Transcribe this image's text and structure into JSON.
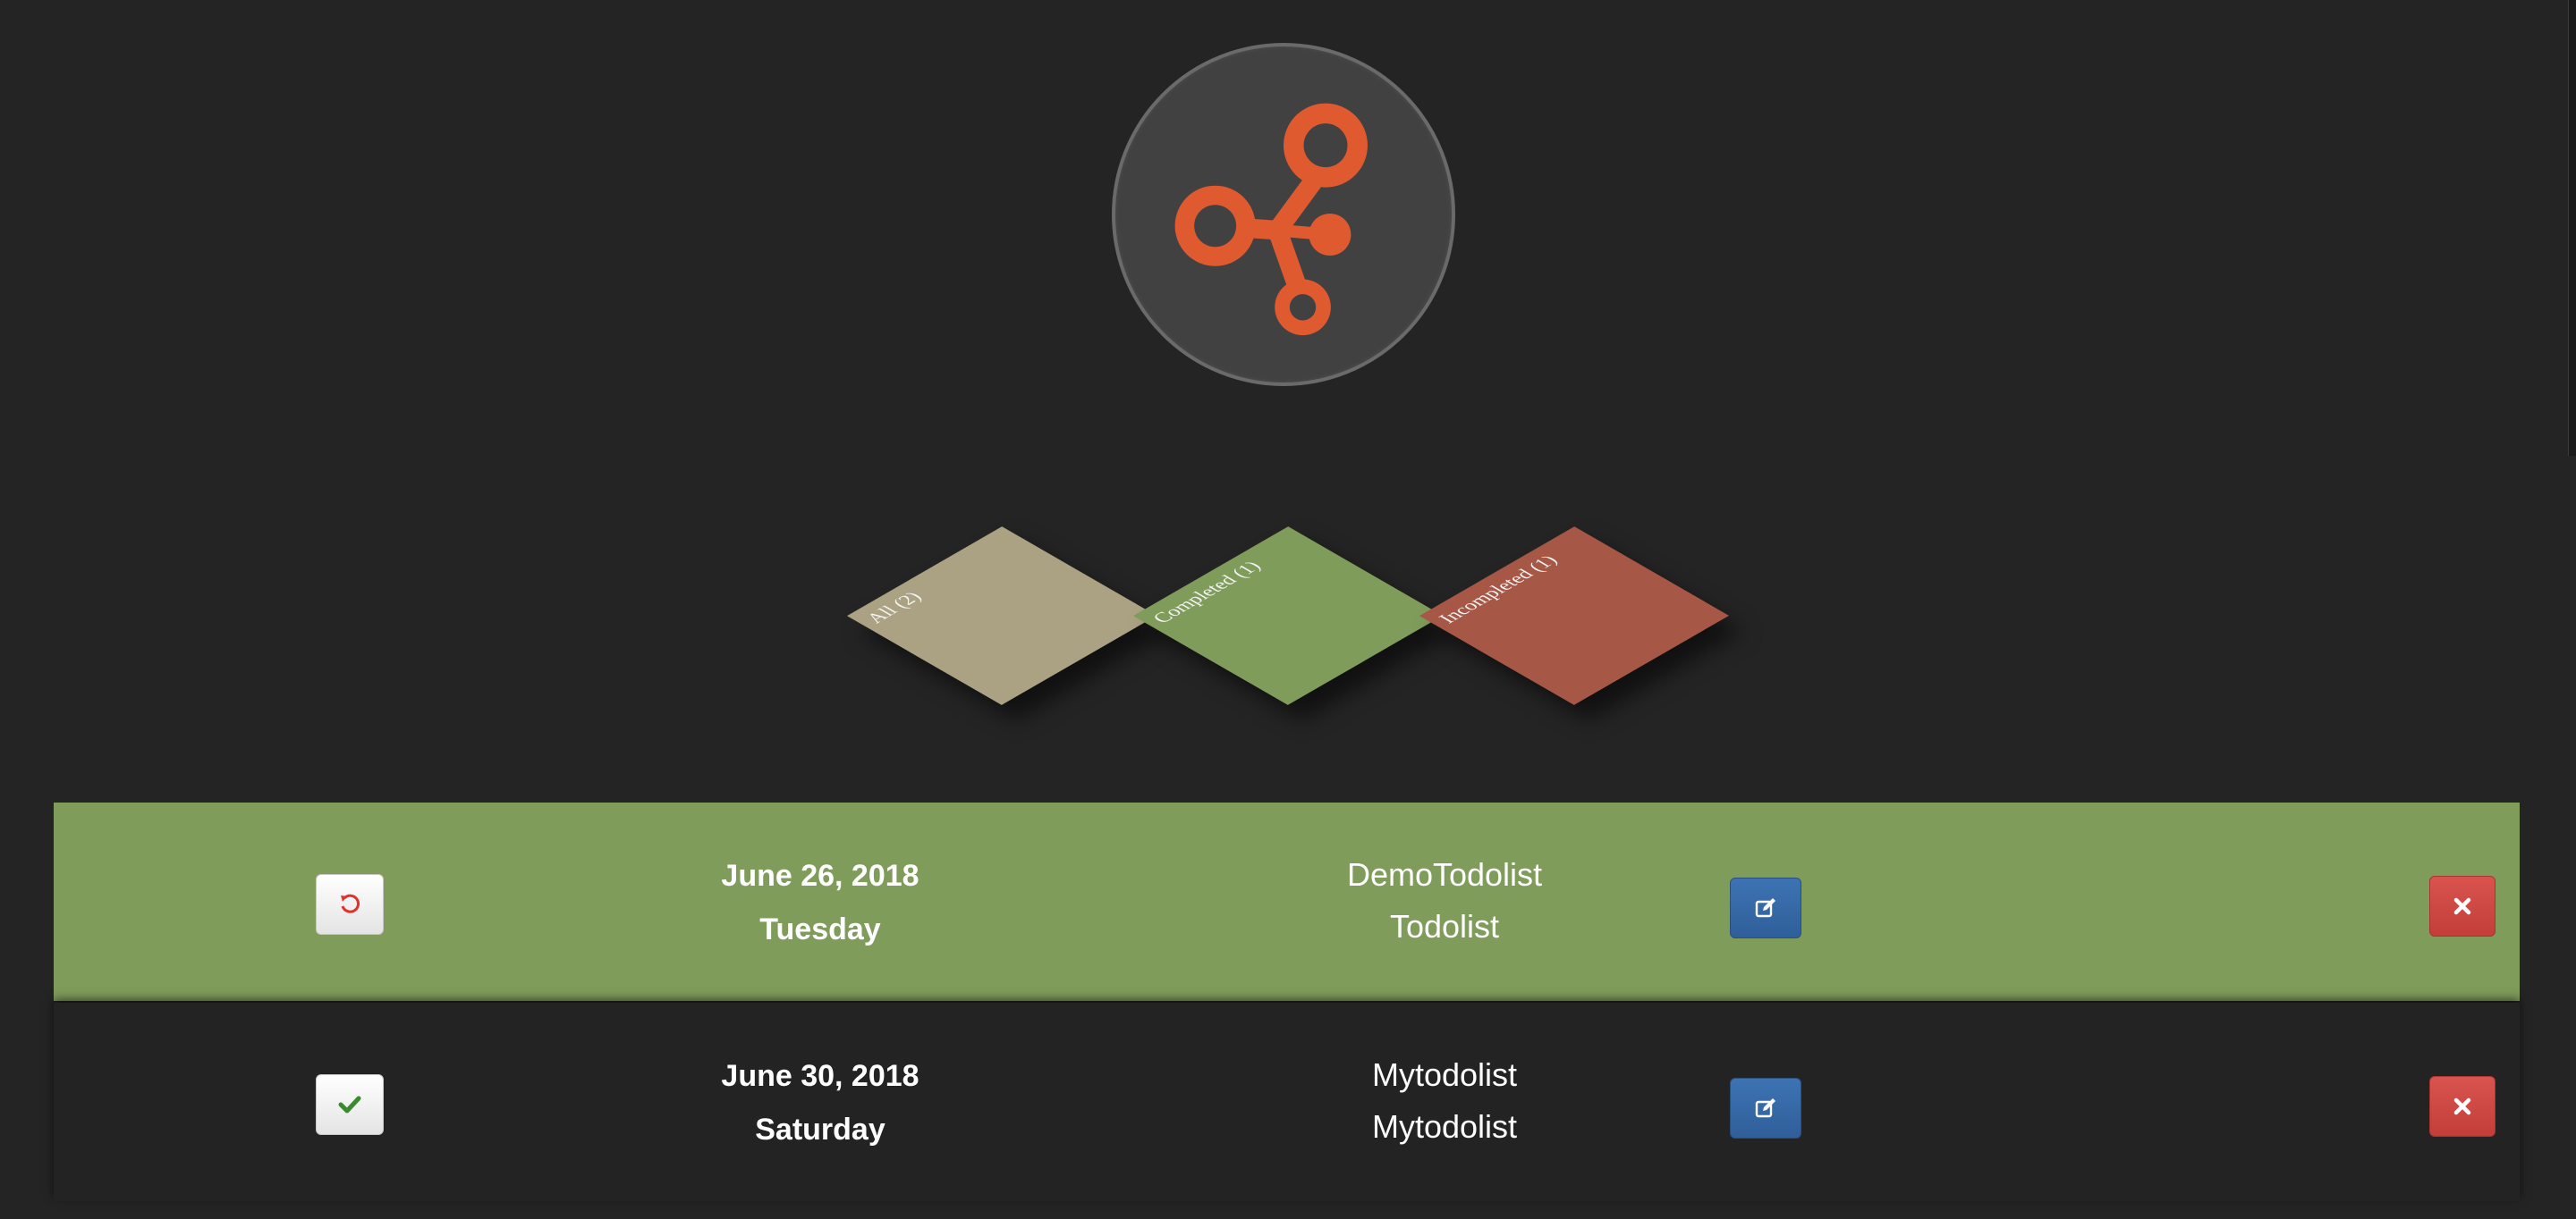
{
  "filters": [
    {
      "label": "All (2)",
      "color": "#aba283"
    },
    {
      "label": "Completed (1)",
      "color": "#7f9c5a"
    },
    {
      "label": "Incompleted (1)",
      "color": "#a65745"
    }
  ],
  "todos": [
    {
      "status": "completed",
      "date": "June 26, 2018",
      "weekday": "Tuesday",
      "name": "DemoTodolist",
      "list": "Todolist",
      "toggle_icon": "undo-icon"
    },
    {
      "status": "incomplete",
      "date": "June 30, 2018",
      "weekday": "Saturday",
      "name": "Mytodolist",
      "list": "Mytodolist",
      "toggle_icon": "check-icon"
    }
  ],
  "colors": {
    "background": "#242424",
    "accent": "#e05a30",
    "completed_row": "#7f9c5a",
    "edit_button": "#3366a8",
    "delete_button": "#d9534f"
  },
  "icons": {
    "logo": "molecule-logo-icon",
    "edit": "edit-icon",
    "delete": "close-icon"
  }
}
